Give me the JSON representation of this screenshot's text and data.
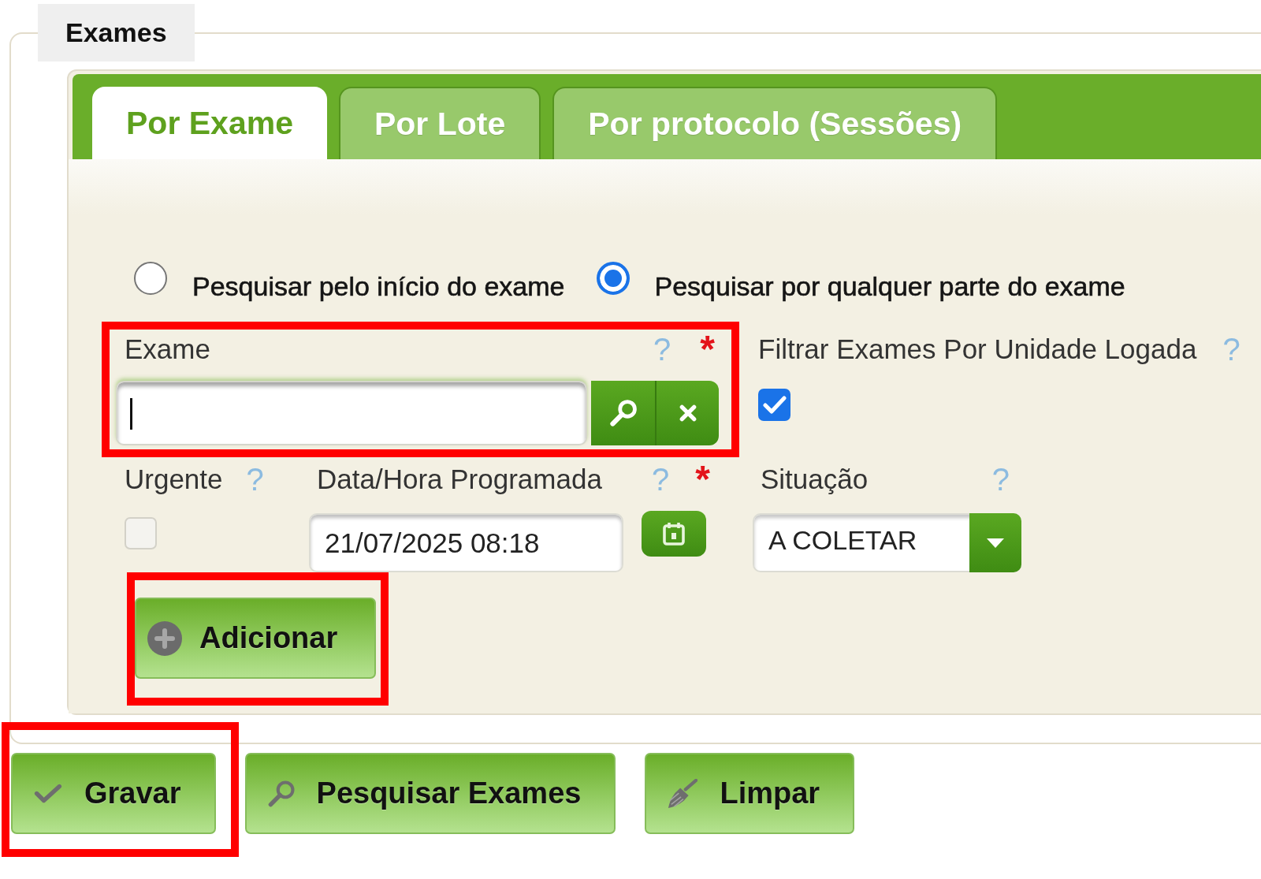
{
  "fieldset": {
    "legend": "Exames"
  },
  "tabs": [
    {
      "label": "Por Exame",
      "selected": true
    },
    {
      "label": "Por Lote",
      "selected": false
    },
    {
      "label": "Por protocolo (Sessões)",
      "selected": false
    }
  ],
  "search_mode": [
    {
      "label": "Pesquisar pelo início do exame",
      "selected": false
    },
    {
      "label": "Pesquisar por qualquer parte do exame",
      "selected": true
    }
  ],
  "exam_field": {
    "label": "Exame",
    "help": "?",
    "required_mark": "*",
    "focused": true,
    "highlighted": true
  },
  "filter_by_unit": {
    "label": "Filtrar Exames Por Unidade Logada",
    "help": "?",
    "checked": true
  },
  "urgent": {
    "label": "Urgente",
    "help": "?",
    "checked": false
  },
  "scheduled_datetime": {
    "label": "Data/Hora Programada",
    "help": "?",
    "required_mark": "*",
    "value": "21/07/2025 08:18"
  },
  "status": {
    "label": "Situação",
    "help": "?",
    "value": "A COLETAR"
  },
  "add_button": {
    "label": "Adicionar",
    "highlighted": true
  },
  "actions": [
    {
      "label": "Gravar",
      "kind": "save",
      "highlighted": true
    },
    {
      "label": "Pesquisar Exames",
      "kind": "search",
      "highlighted": false
    },
    {
      "label": "Limpar",
      "kind": "clear",
      "highlighted": false
    }
  ]
}
